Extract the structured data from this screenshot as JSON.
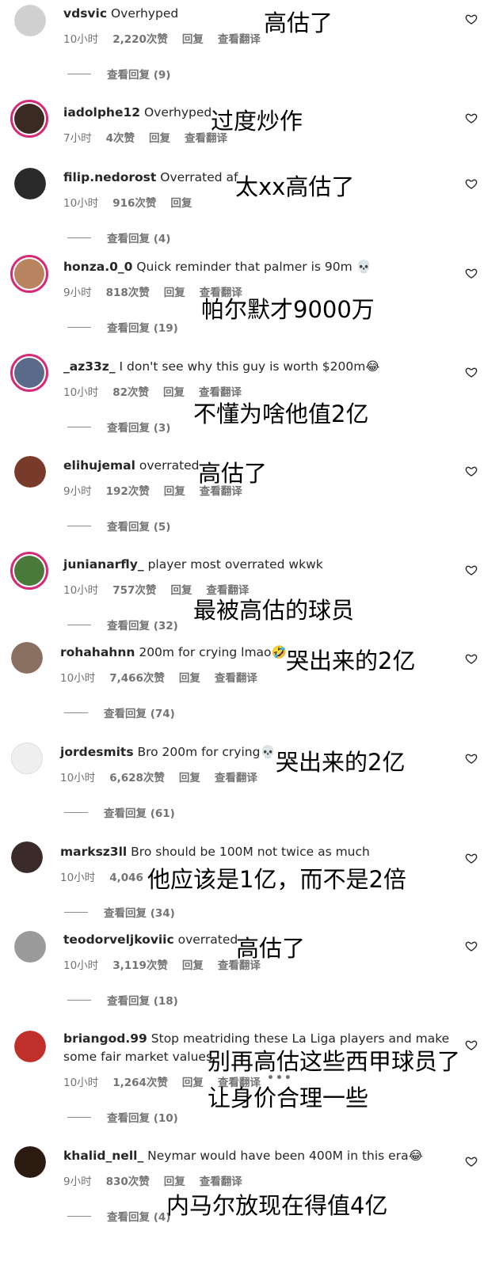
{
  "labels": {
    "reply": "回复",
    "translate": "查看翻译"
  },
  "comments": [
    {
      "username": "vdsvic",
      "text": "Overhyped",
      "time": "10小时",
      "likes": "2,220次赞",
      "replies": "查看回复 (9)",
      "translation": "高估了",
      "avatar_color": "#c8c8c8"
    },
    {
      "username": "iadolphe12",
      "text": "Overhyped",
      "time": "7小时",
      "likes": "4次赞",
      "replies": "",
      "translation": "过度炒作",
      "avatar_color": "#3a2a22"
    },
    {
      "username": "filip.nedorost",
      "text": "Overrated af",
      "time": "10小时",
      "likes": "916次赞",
      "replies": "查看回复 (4)",
      "translation": "太xx高估了",
      "avatar_color": "#2a2a2a"
    },
    {
      "username": "honza.0_0",
      "text": "Quick reminder that palmer is 90m 💀",
      "time": "9小时",
      "likes": "818次赞",
      "replies": "查看回复 (19)",
      "translation": "帕尔默才9000万",
      "avatar_color": "#b8845f"
    },
    {
      "username": "_az33z_",
      "text": "I don't see why this guy is worth $200m😂",
      "time": "10小时",
      "likes": "82次赞",
      "replies": "查看回复 (3)",
      "translation": "不懂为啥他值2亿",
      "avatar_color": "#5a6a8a"
    },
    {
      "username": "elihujemal",
      "text": "overrated",
      "time": "9小时",
      "likes": "192次赞",
      "replies": "查看回复 (5)",
      "translation": "高估了",
      "avatar_color": "#7a3a2a"
    },
    {
      "username": "junianarfly_",
      "text": "player most overrated wkwk",
      "time": "10小时",
      "likes": "757次赞",
      "replies": "查看回复 (32)",
      "translation": "最被高估的球员",
      "avatar_color": "#4a7a3a"
    },
    {
      "username": "rohahahnn",
      "text": "200m for crying lmao🤣",
      "time": "10小时",
      "likes": "7,466次赞",
      "replies": "查看回复 (74)",
      "translation": "哭出来的2亿",
      "avatar_color": "#8a7060"
    },
    {
      "username": "jordesmits",
      "text": "Bro 200m for crying💀",
      "time": "10小时",
      "likes": "6,628次赞",
      "replies": "查看回复 (61)",
      "translation": "哭出来的2亿",
      "avatar_color": "#dcdcdc"
    },
    {
      "username": "marksz3ll",
      "text": "Bro should be 100M not twice as much",
      "time": "10小时",
      "likes": "4,046",
      "replies": "查看回复 (34)",
      "translation": "他应该是1亿，而不是2倍",
      "avatar_color": "#3a2a2a"
    },
    {
      "username": "teodorveljkoviic",
      "text": "overrated",
      "time": "10小时",
      "likes": "3,119次赞",
      "replies": "查看回复 (18)",
      "translation": "高估了",
      "avatar_color": "#9a9a9a"
    },
    {
      "username": "briangod.99",
      "text": "Stop meatriding these La Liga players and make",
      "text2": "some fair market values",
      "time": "10小时",
      "likes": "1,264次赞",
      "replies": "查看回复 (10)",
      "translation": "别再高估这些西甲球员了",
      "translation2": "让身价合理一些",
      "avatar_color": "#c0302a"
    },
    {
      "username": "khalid_nell_",
      "text": "Neymar would have been 400M in this era😂",
      "time": "9小时",
      "likes": "830次赞",
      "replies": "查看回复 (4)",
      "translation": "内马尔放现在得值4亿",
      "avatar_color": "#2a1a10"
    }
  ]
}
